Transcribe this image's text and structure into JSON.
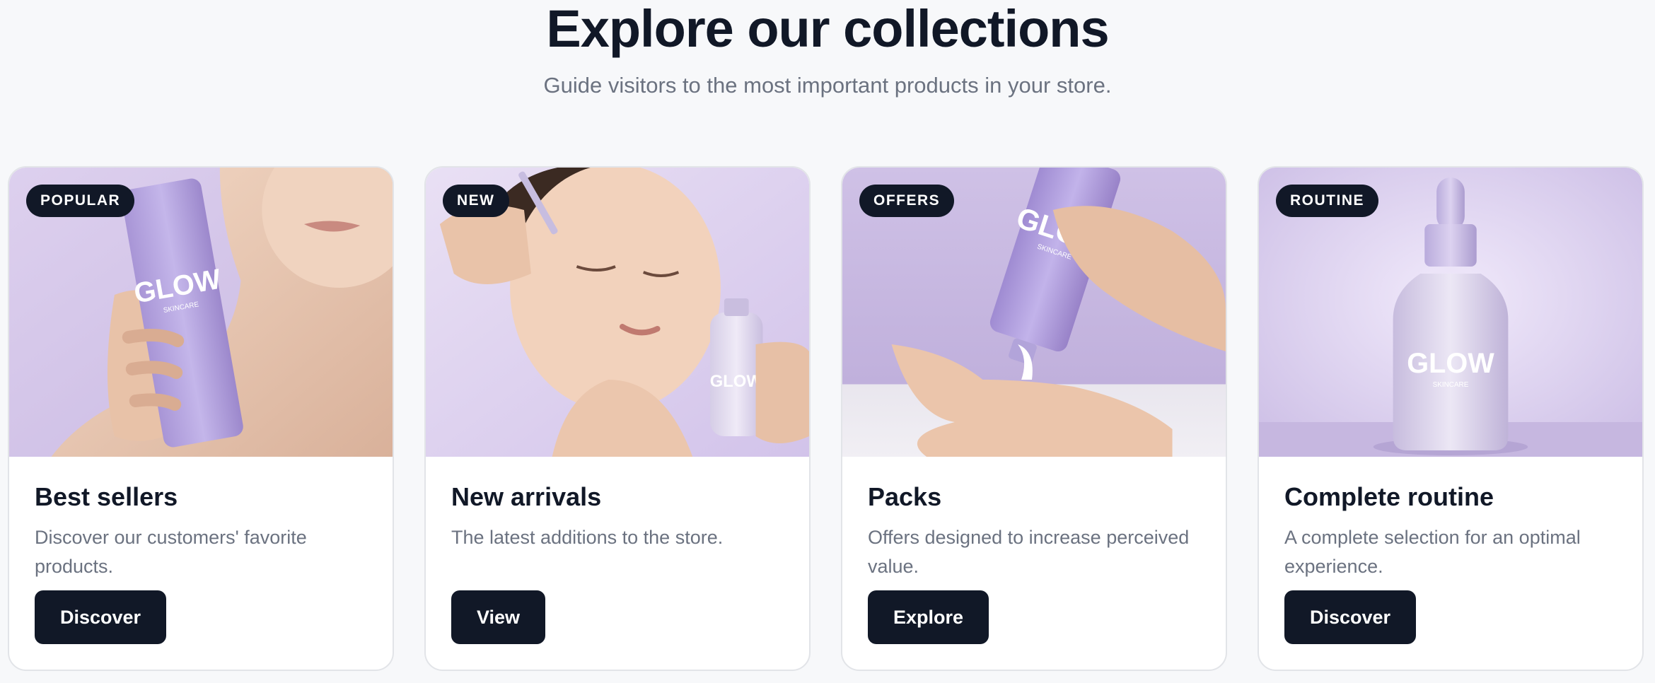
{
  "header": {
    "title": "Explore our collections",
    "subtitle": "Guide visitors to the most important products in your store."
  },
  "brand": {
    "logo_text": "GLOW",
    "logo_sub": "SKINCARE"
  },
  "cards": [
    {
      "badge": "POPULAR",
      "title": "Best sellers",
      "description": "Discover our customers' favorite products.",
      "button": "Discover",
      "image": "woman-holding-lavender-tube"
    },
    {
      "badge": "NEW",
      "title": "New arrivals",
      "description": "The latest additions to the store.",
      "button": "View",
      "image": "woman-applying-serum-dropper"
    },
    {
      "badge": "OFFERS",
      "title": "Packs",
      "description": "Offers designed to increase perceived value.",
      "button": "Explore",
      "image": "hands-squeezing-cream-tube"
    },
    {
      "badge": "ROUTINE",
      "title": "Complete routine",
      "description": "A complete selection for an optimal experience.",
      "button": "Discover",
      "image": "serum-dropper-bottle"
    }
  ],
  "colors": {
    "background": "#f7f8fa",
    "dark": "#111827",
    "muted_text": "#6b7280",
    "lavender": "#b8a9de",
    "lavender_light": "#e6dcf4"
  }
}
